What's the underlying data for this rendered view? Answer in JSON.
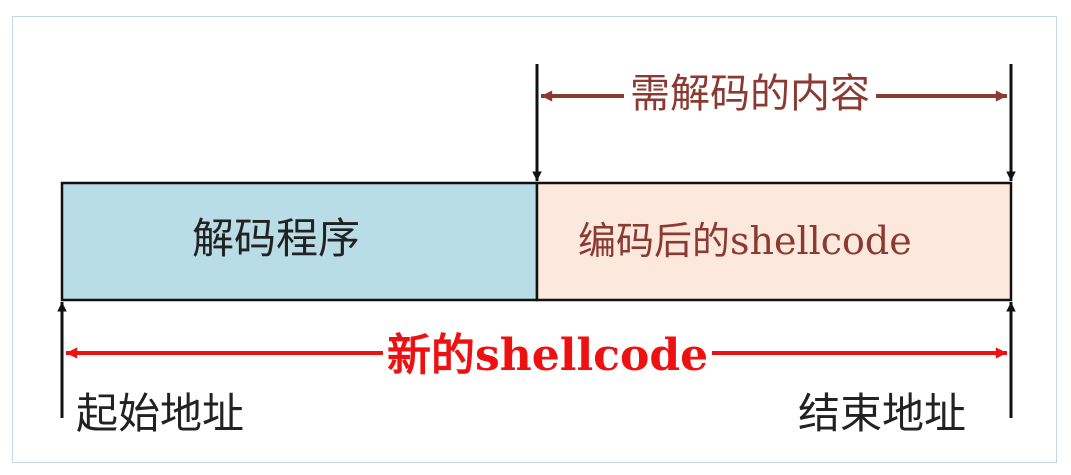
{
  "blocks": [
    {
      "label": "解码程序",
      "fill": "#b9dde6"
    },
    {
      "label": "编码后的shellcode",
      "fill": "#fce8dc"
    }
  ],
  "span_label": "需解码的内容",
  "new_label": "新的shellcode",
  "start_label": "起始地址",
  "end_label": "结束地址",
  "colors": {
    "outline": "#111111",
    "span_arrow": "#8b3a32",
    "new_arrow": "#ee1111",
    "frame": "#c7d6e3"
  }
}
